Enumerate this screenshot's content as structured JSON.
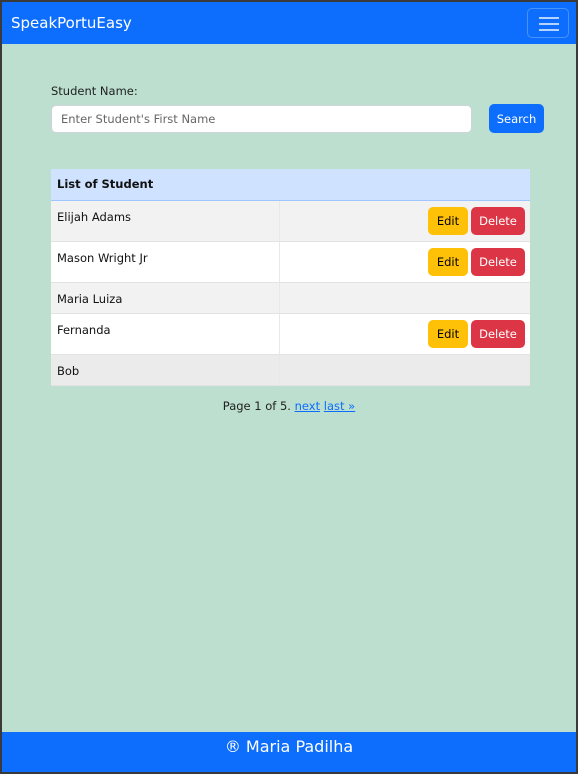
{
  "navbar": {
    "brand": "SpeakPortuEasy",
    "toggle_icon": "hamburger-menu-icon"
  },
  "search": {
    "label": "Student Name:",
    "placeholder": "Enter Student's First Name",
    "value": "",
    "button_label": "Search"
  },
  "table": {
    "header": "List of Student",
    "rows": [
      {
        "name": "Elijah Adams",
        "edit_label": "Edit",
        "delete_label": "Delete"
      },
      {
        "name": "Mason Wright Jr",
        "edit_label": "Edit",
        "delete_label": "Delete"
      },
      {
        "name": "Maria Luiza"
      },
      {
        "name": "Fernanda",
        "edit_label": "Edit",
        "delete_label": "Delete"
      },
      {
        "name": "Bob"
      }
    ]
  },
  "pagination": {
    "status": "Page 1 of 5.",
    "next_label": "next",
    "last_label": "last »"
  },
  "footer": {
    "text": "® Maria Padilha"
  },
  "colors": {
    "primary": "#0d6efd",
    "background": "#bcdfcf",
    "table_header": "#cfe2ff",
    "edit": "#ffc107",
    "delete": "#dc3545"
  }
}
